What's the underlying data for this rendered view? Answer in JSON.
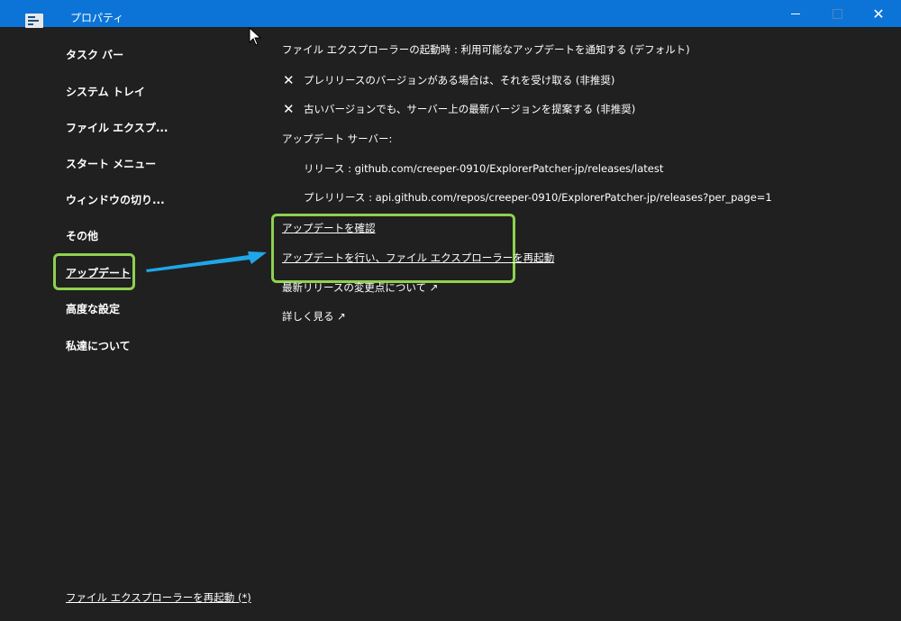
{
  "window": {
    "title": "プロパティ",
    "icon": "app-properties-icon",
    "controls": [
      "minimize-icon",
      "maximize-icon",
      "close-icon"
    ]
  },
  "sidebar": {
    "items": [
      {
        "label": "タスク バー"
      },
      {
        "label": "システム トレイ"
      },
      {
        "label": "ファイル エクスプ..."
      },
      {
        "label": "スタート メニュー"
      },
      {
        "label": "ウィンドウの切り..."
      },
      {
        "label": "その他"
      },
      {
        "label": "アップデート",
        "active": true
      },
      {
        "label": "高度な設定"
      },
      {
        "label": "私達について"
      }
    ],
    "footer_link": "ファイル エクスプローラーを再起動 (*)"
  },
  "main": {
    "startup_setting": "ファイル エクスプローラーの起動時 : 利用可能なアップデートを通知する (デフォルト)",
    "prerelease_option": "プレリリースのバージョンがある場合は、それを受け取る (非推奨)",
    "older_version_option": "古いバージョンでも、サーバー上の最新バージョンを提案する (非推奨)",
    "server_heading": "アップデート サーバー:",
    "release_server": "リリース : github.com/creeper-0910/ExplorerPatcher-jp/releases/latest",
    "prerelease_server": "プレリリース : api.github.com/repos/creeper-0910/ExplorerPatcher-jp/releases?per_page=1",
    "check_updates": "アップデートを確認",
    "update_and_restart": "アップデートを行い、ファイル エクスプローラーを再起動",
    "release_notes": "最新リリースの変更点について ↗",
    "learn_more": "詳しく見る ↗"
  },
  "colors": {
    "titlebar": "#0b74d6",
    "background": "#202020",
    "highlight": "#8fd14f",
    "arrow": "#1ea7e8"
  }
}
